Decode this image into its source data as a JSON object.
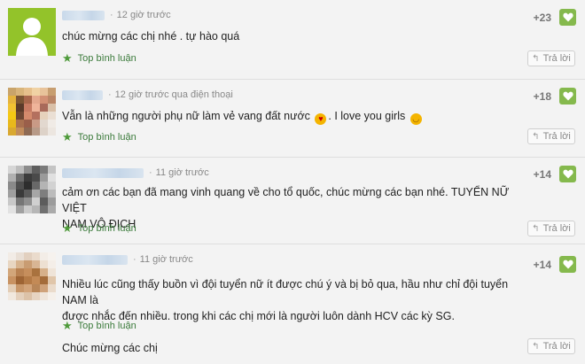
{
  "comments": [
    {
      "time": "12 giờ trước",
      "score": "+23",
      "lines": [
        "chúc mừng các chị nhé . tự hào quá"
      ],
      "badge": "Top bình luận",
      "reply": "Trả lời",
      "avatar": "default"
    },
    {
      "time": "12 giờ trước qua điện thoại",
      "score": "+18",
      "line_a": "Vẫn là những người phụ nữ làm vẻ vang đất nước",
      "line_b": ". I love you girls",
      "badge": "Top bình luận",
      "reply": "Trả lời",
      "avatar": "pixel-warm"
    },
    {
      "time": "11 giờ trước",
      "score": "+14",
      "lines": [
        "cảm ơn các bạn đã mang vinh quang về cho tổ quốc, chúc mừng các bạn nhé. TUYỂN NỮ VIỆT",
        "NAM VÔ ĐỊCH"
      ],
      "badge": "Top bình luận",
      "reply": "Trả lời",
      "avatar": "pixel-gray"
    },
    {
      "time": "11 giờ trước",
      "score": "+14",
      "lines": [
        "Nhiều lúc cũng thấy buồn vì đội tuyển nữ ít được chú ý và bị bỏ qua, hầu như chỉ đội tuyển NAM là",
        "được nhắc đến nhiều. trong khi các chị mới là người luôn dành HCV các kỳ SG."
      ],
      "extra": "Chúc mừng các chị",
      "badge": "Top bình luận",
      "reply": "Trả lời",
      "avatar": "pixel-skin"
    }
  ],
  "colors": {
    "accent_green": "#85b94d",
    "background": "#f3f3f3"
  }
}
